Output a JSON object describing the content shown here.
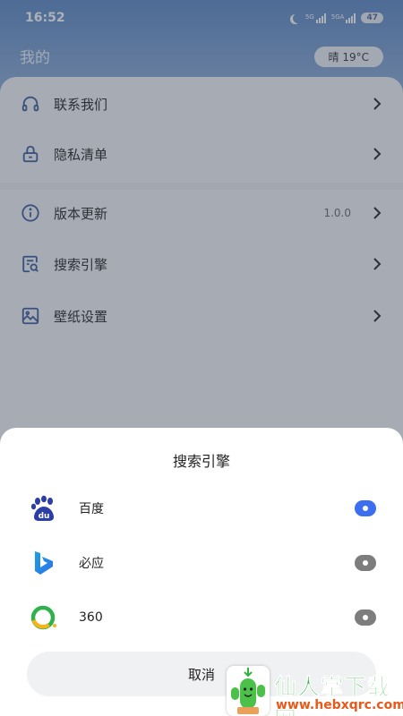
{
  "status": {
    "time": "16:52",
    "sig1": "5G",
    "sig2": "5GA",
    "battery": "47"
  },
  "header": {
    "title": "我的",
    "weather": "晴 19°C"
  },
  "menu": [
    {
      "icon": "headset-icon",
      "label": "联系我们"
    },
    {
      "icon": "lock-icon",
      "label": "隐私清单"
    },
    {
      "icon": "info-icon",
      "label": "版本更新",
      "value": "1.0.0"
    },
    {
      "icon": "search-engine-icon",
      "label": "搜索引擎"
    },
    {
      "icon": "wallpaper-icon",
      "label": "壁纸设置"
    }
  ],
  "sheet": {
    "title": "搜索引擎",
    "options": [
      {
        "icon": "baidu-logo",
        "label": "百度",
        "selected": true
      },
      {
        "icon": "bing-logo",
        "label": "必应",
        "selected": false
      },
      {
        "icon": "360-logo",
        "label": "360",
        "selected": false
      }
    ],
    "cancel": "取消"
  },
  "watermark": {
    "text": "仙人掌下载网",
    "url": "www.hebxqrc.com"
  },
  "colors": {
    "accent": "#3b6ff0",
    "hero": "#5b87c4"
  }
}
